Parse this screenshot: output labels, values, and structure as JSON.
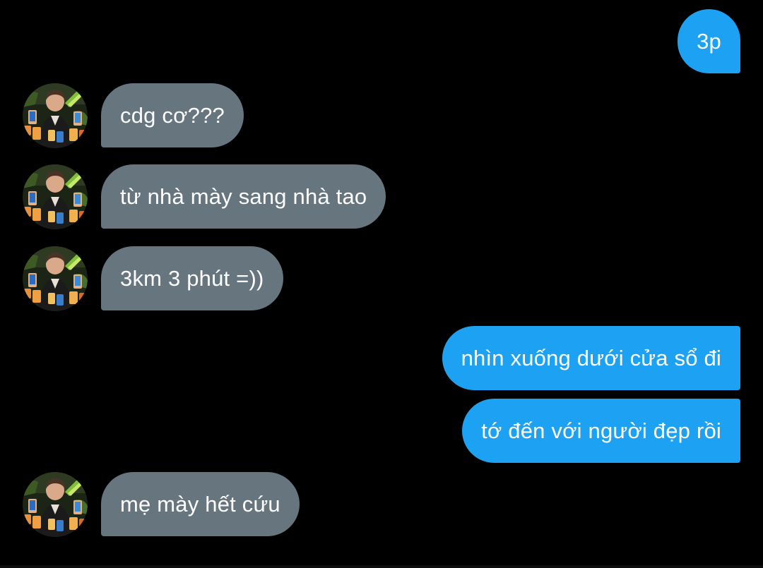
{
  "messages": [
    {
      "side": "outgoing",
      "text": "3p"
    },
    {
      "side": "incoming",
      "text": "cdg cơ???"
    },
    {
      "side": "incoming",
      "text": "từ nhà mày sang nhà tao"
    },
    {
      "side": "incoming",
      "text": "3km 3 phút =))"
    },
    {
      "side": "outgoing",
      "text": "nhìn xuống dưới cửa sổ đi"
    },
    {
      "side": "outgoing",
      "text": "tớ đến với người đẹp rồi"
    },
    {
      "side": "incoming",
      "text": "mẹ mày hết cứu"
    }
  ],
  "colors": {
    "background": "#000000",
    "incoming_bubble": "#67757f",
    "outgoing_bubble": "#1da1f2",
    "text": "#ffffff"
  },
  "icons": {
    "sender_avatar": "avatar-photo"
  }
}
